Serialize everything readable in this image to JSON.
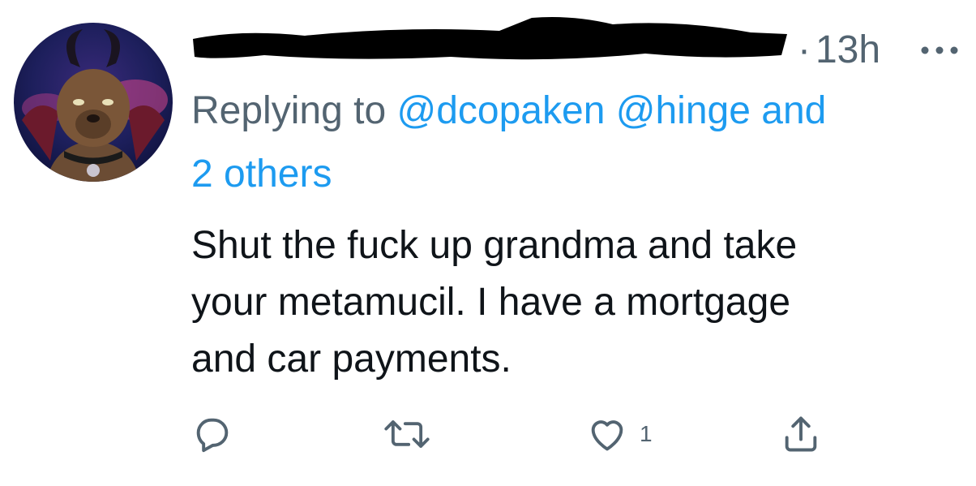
{
  "tweet": {
    "timestamp": "13h",
    "dot": "·",
    "replying_prefix": "Replying to",
    "mentions": [
      "@dcopaken",
      "@hinge"
    ],
    "and_label": "and",
    "others_label": "2 others",
    "text": "Shut the fuck up grandma and take\nyour metamucil. I have a mortgage\nand car payments.",
    "like_count": "1"
  },
  "icons": {
    "more": "more-horizontal-icon",
    "reply": "reply-bubble-icon",
    "retweet": "retweet-icon",
    "like": "heart-icon",
    "share": "share-upload-icon"
  },
  "colors": {
    "text": "#0f1419",
    "secondary": "#536471",
    "link": "#1d9bf0",
    "background": "#ffffff"
  }
}
